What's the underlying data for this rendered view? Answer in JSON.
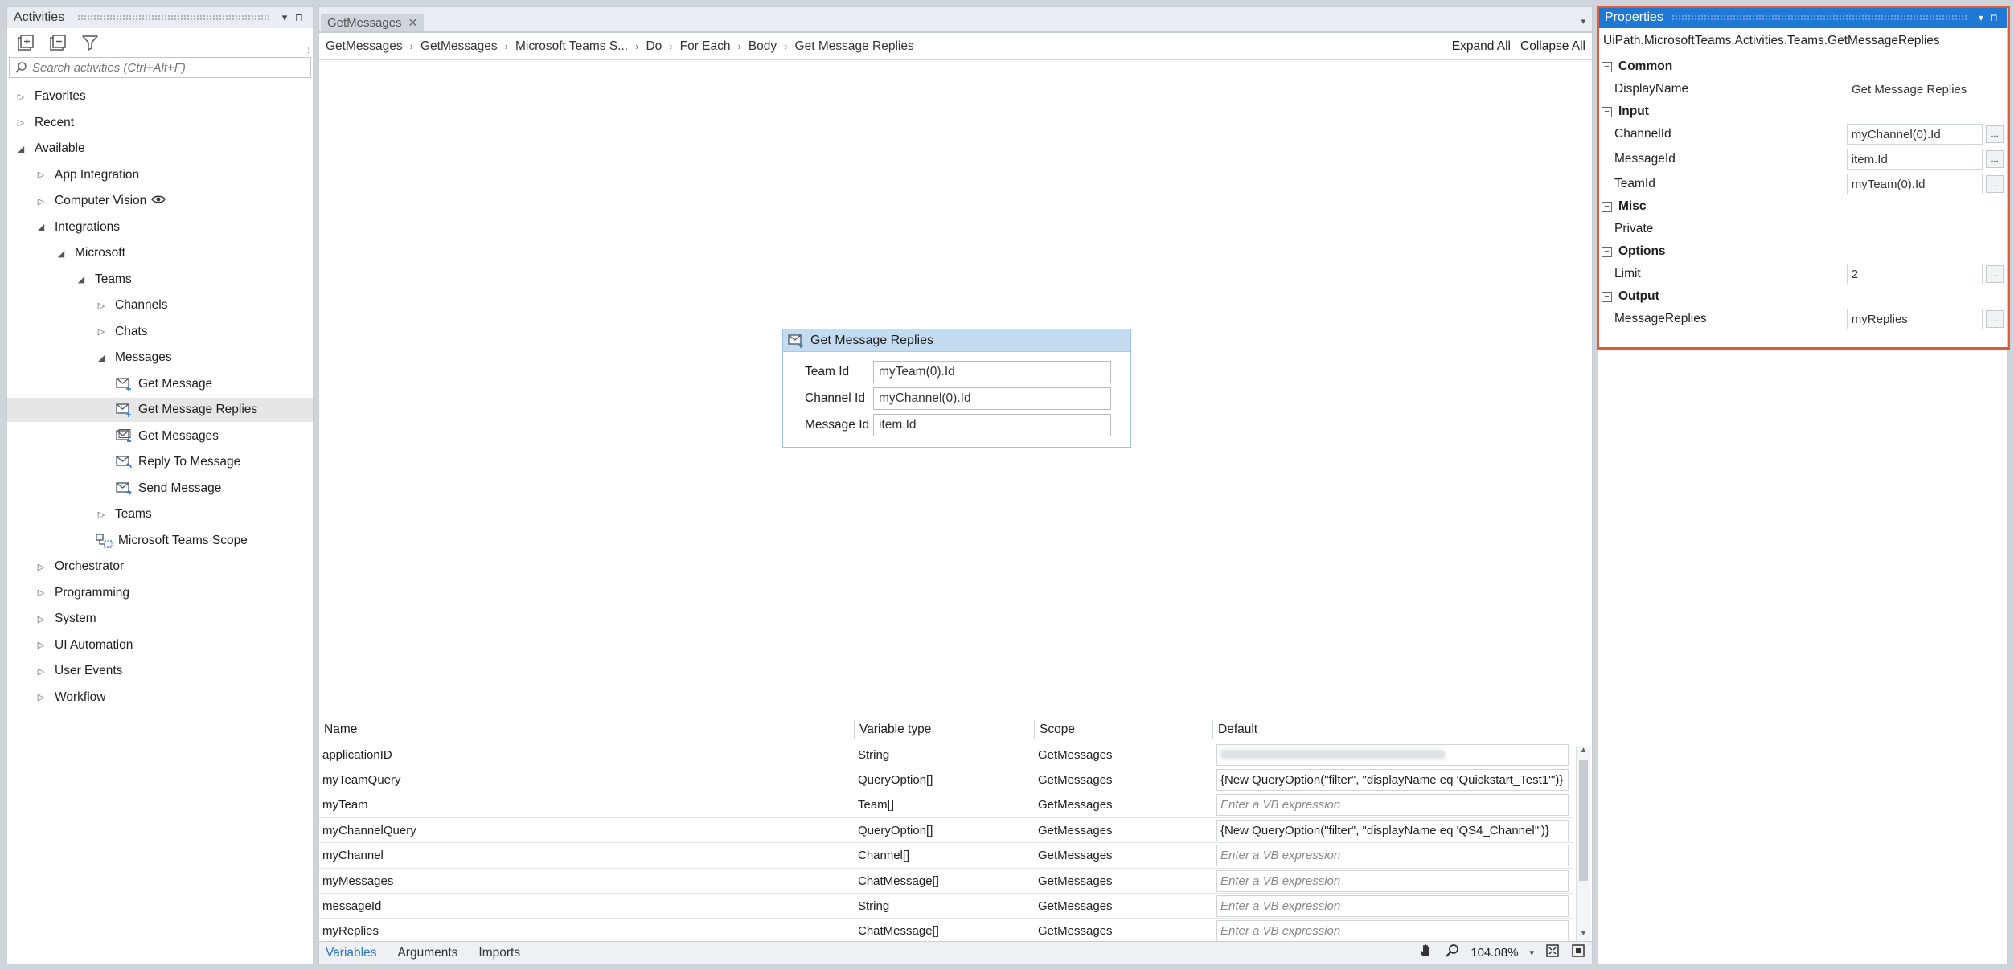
{
  "activities": {
    "title": "Activities",
    "search_placeholder": "Search activities (Ctrl+Alt+F)",
    "tree": [
      {
        "label": "Favorites",
        "level": 0,
        "state": "collapsed"
      },
      {
        "label": "Recent",
        "level": 0,
        "state": "collapsed"
      },
      {
        "label": "Available",
        "level": 0,
        "state": "expanded"
      },
      {
        "label": "App Integration",
        "level": 1,
        "state": "collapsed"
      },
      {
        "label": "Computer Vision",
        "level": 1,
        "state": "collapsed",
        "badge_icon": "eye-icon"
      },
      {
        "label": "Integrations",
        "level": 1,
        "state": "expanded"
      },
      {
        "label": "Microsoft",
        "level": 2,
        "state": "expanded"
      },
      {
        "label": "Teams",
        "level": 3,
        "state": "expanded"
      },
      {
        "label": "Channels",
        "level": 4,
        "state": "collapsed"
      },
      {
        "label": "Chats",
        "level": 4,
        "state": "collapsed"
      },
      {
        "label": "Messages",
        "level": 4,
        "state": "expanded"
      },
      {
        "label": "Get Message",
        "level": 5,
        "state": "leaf",
        "icon": "message-activity-icon"
      },
      {
        "label": "Get Message Replies",
        "level": 5,
        "state": "leaf",
        "icon": "message-activity-icon",
        "selected": true
      },
      {
        "label": "Get Messages",
        "level": 5,
        "state": "leaf",
        "icon": "messages-activity-icon"
      },
      {
        "label": "Reply To Message",
        "level": 5,
        "state": "leaf",
        "icon": "reply-activity-icon"
      },
      {
        "label": "Send Message",
        "level": 5,
        "state": "leaf",
        "icon": "send-activity-icon"
      },
      {
        "label": "Teams",
        "level": 4,
        "state": "collapsed"
      },
      {
        "label": "Microsoft Teams Scope",
        "level": 4,
        "state": "leaf",
        "icon": "scope-activity-icon"
      },
      {
        "label": "Orchestrator",
        "level": 1,
        "state": "collapsed"
      },
      {
        "label": "Programming",
        "level": 1,
        "state": "collapsed"
      },
      {
        "label": "System",
        "level": 1,
        "state": "collapsed"
      },
      {
        "label": "UI Automation",
        "level": 1,
        "state": "collapsed"
      },
      {
        "label": "User Events",
        "level": 1,
        "state": "collapsed"
      },
      {
        "label": "Workflow",
        "level": 1,
        "state": "collapsed"
      }
    ]
  },
  "designer": {
    "tab_label": "GetMessages",
    "breadcrumb": [
      "GetMessages",
      "GetMessages",
      "Microsoft Teams S...",
      "Do",
      "For Each",
      "Body",
      "Get Message Replies"
    ],
    "expand_all": "Expand All",
    "collapse_all": "Collapse All",
    "activity": {
      "title": "Get Message Replies",
      "fields": [
        {
          "label": "Team Id",
          "value": "myTeam(0).Id"
        },
        {
          "label": "Channel Id",
          "value": "myChannel(0).Id"
        },
        {
          "label": "Message Id",
          "value": "item.Id"
        }
      ]
    },
    "variables": {
      "headers": [
        "Name",
        "Variable type",
        "Scope",
        "Default"
      ],
      "rows": [
        {
          "name": "applicationID",
          "type": "String",
          "scope": "GetMessages",
          "default": "",
          "blurred": true
        },
        {
          "name": "myTeamQuery",
          "type": "QueryOption[]",
          "scope": "GetMessages",
          "default": "{New QueryOption(\"filter\", \"displayName eq 'Quickstart_Test1'\")}"
        },
        {
          "name": "myTeam",
          "type": "Team[]",
          "scope": "GetMessages",
          "default": "",
          "placeholder": "Enter a VB expression"
        },
        {
          "name": "myChannelQuery",
          "type": "QueryOption[]",
          "scope": "GetMessages",
          "default": "{New QueryOption(\"filter\", \"displayName eq 'QS4_Channel'\")}"
        },
        {
          "name": "myChannel",
          "type": "Channel[]",
          "scope": "GetMessages",
          "default": "",
          "placeholder": "Enter a VB expression"
        },
        {
          "name": "myMessages",
          "type": "ChatMessage[]",
          "scope": "GetMessages",
          "default": "",
          "placeholder": "Enter a VB expression"
        },
        {
          "name": "messageId",
          "type": "String",
          "scope": "GetMessages",
          "default": "",
          "placeholder": "Enter a VB expression"
        },
        {
          "name": "myReplies",
          "type": "ChatMessage[]",
          "scope": "GetMessages",
          "default": "",
          "placeholder": "Enter a VB expression"
        }
      ]
    },
    "bottom_tabs": [
      "Variables",
      "Arguments",
      "Imports"
    ],
    "zoom": "104.08%"
  },
  "properties": {
    "title": "Properties",
    "class_name": "UiPath.MicrosoftTeams.Activities.Teams.GetMessageReplies",
    "categories": [
      {
        "name": "Common",
        "props": [
          {
            "name": "DisplayName",
            "value": "Get Message Replies",
            "kind": "plain"
          }
        ]
      },
      {
        "name": "Input",
        "props": [
          {
            "name": "ChannelId",
            "value": "myChannel(0).Id",
            "kind": "expr"
          },
          {
            "name": "MessageId",
            "value": "item.Id",
            "kind": "expr"
          },
          {
            "name": "TeamId",
            "value": "myTeam(0).Id",
            "kind": "expr"
          }
        ]
      },
      {
        "name": "Misc",
        "props": [
          {
            "name": "Private",
            "value": "",
            "kind": "checkbox"
          }
        ]
      },
      {
        "name": "Options",
        "props": [
          {
            "name": "Limit",
            "value": "2",
            "kind": "expr"
          }
        ]
      },
      {
        "name": "Output",
        "props": [
          {
            "name": "MessageReplies",
            "value": "myReplies",
            "kind": "expr"
          }
        ]
      }
    ]
  },
  "colors": {
    "accent": "#1e78d6",
    "highlight_frame": "#e05a3c",
    "activity_header": "#c4dcf2"
  }
}
